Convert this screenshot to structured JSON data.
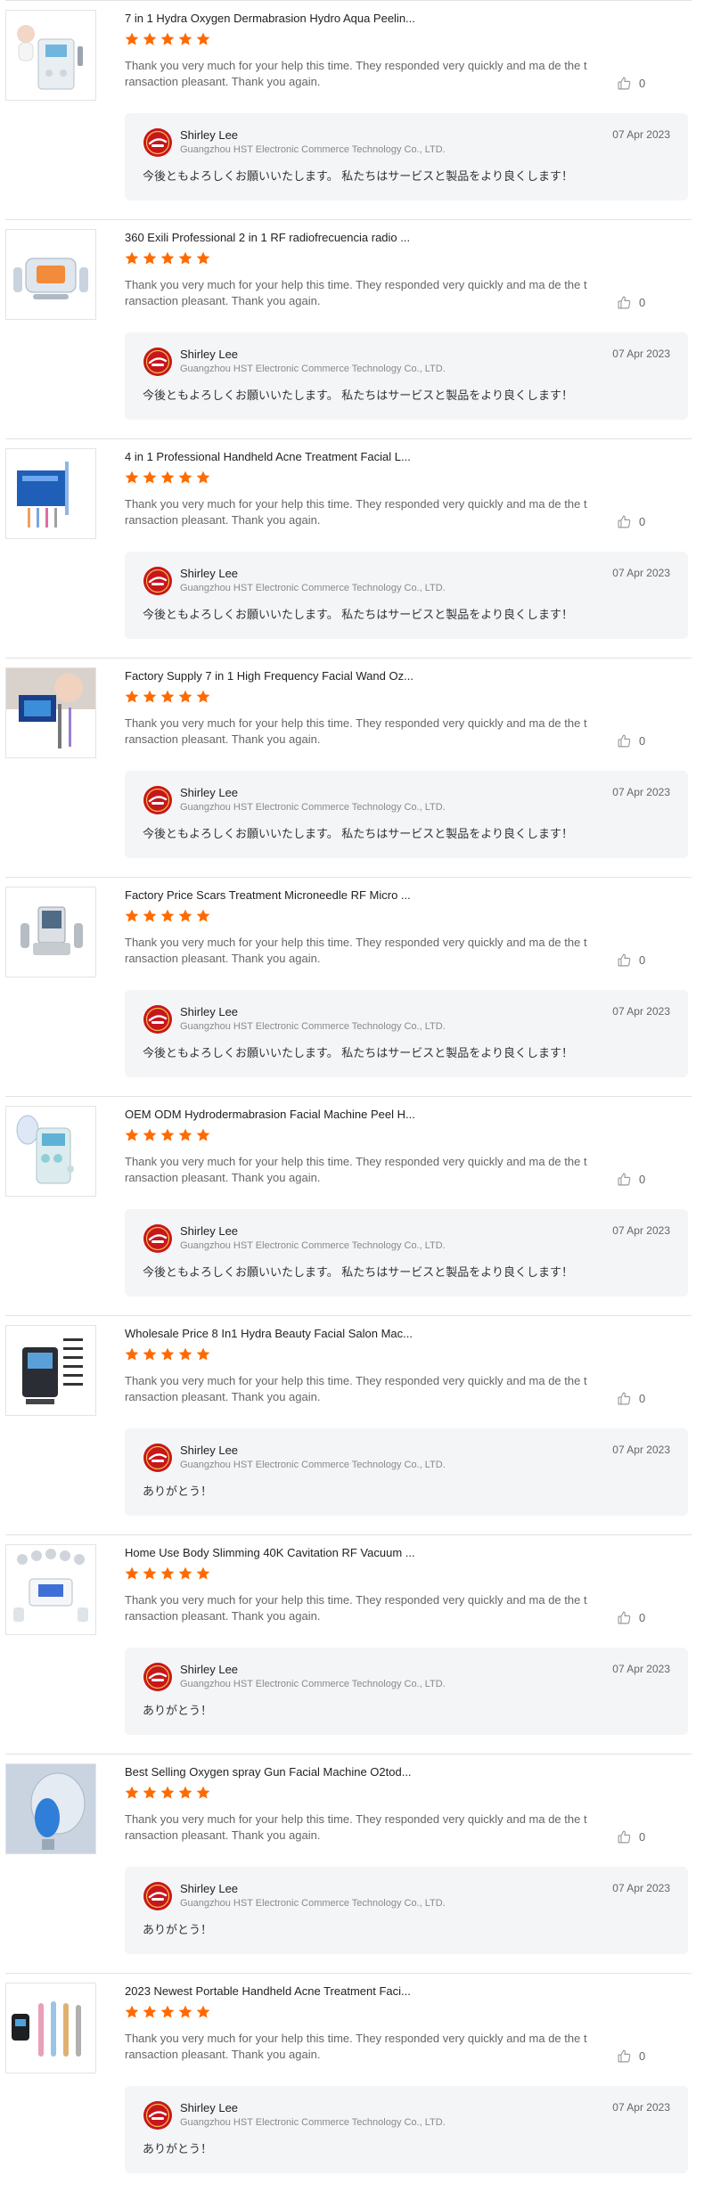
{
  "colors": {
    "star": "#ff6a00",
    "divider": "#e2e2e2",
    "reply_bg": "#f4f5f7",
    "logo": "#c8161d"
  },
  "reviews": [
    {
      "title": "7 in 1 Hydra Oxygen Dermabrasion Hydro Aqua Peelin...",
      "rating": 5,
      "comment": "Thank you very much for your help this time. They responded very quickly and ma de the transaction pleasant. Thank you again.",
      "likes": "0",
      "thumb": "hydra-machine",
      "reply": {
        "name": "Shirley Lee",
        "company": "Guangzhou HST Electronic Commerce Technology Co., LTD.",
        "date": "07 Apr 2023",
        "text": "今後ともよろしくお願いいたします。 私たちはサービスと製品をより良くします！"
      }
    },
    {
      "title": "360 Exili Professional 2 in 1 RF radiofrecuencia radio ...",
      "rating": 5,
      "comment": "Thank you very much for your help this time. They responded very quickly and ma de the transaction pleasant. Thank you again.",
      "likes": "0",
      "thumb": "rf-machine",
      "reply": {
        "name": "Shirley Lee",
        "company": "Guangzhou HST Electronic Commerce Technology Co., LTD.",
        "date": "07 Apr 2023",
        "text": "今後ともよろしくお願いいたします。 私たちはサービスと製品をより良くします！"
      }
    },
    {
      "title": "4 in 1 Professional Handheld Acne Treatment Facial L...",
      "rating": 5,
      "comment": "Thank you very much for your help this time. They responded very quickly and ma de the transaction pleasant. Thank you again.",
      "likes": "0",
      "thumb": "wand-box",
      "reply": {
        "name": "Shirley Lee",
        "company": "Guangzhou HST Electronic Commerce Technology Co., LTD.",
        "date": "07 Apr 2023",
        "text": "今後ともよろしくお願いいたします。 私たちはサービスと製品をより良くします！"
      }
    },
    {
      "title": "Factory Supply 7 in 1 High Frequency Facial Wand Oz...",
      "rating": 5,
      "comment": "Thank you very much for your help this time. They responded very quickly and ma de the transaction pleasant. Thank you again.",
      "likes": "0",
      "thumb": "face-wand",
      "reply": {
        "name": "Shirley Lee",
        "company": "Guangzhou HST Electronic Commerce Technology Co., LTD.",
        "date": "07 Apr 2023",
        "text": "今後ともよろしくお願いいたします。 私たちはサービスと製品をより良くします！"
      }
    },
    {
      "title": "Factory Price Scars Treatment Microneedle RF Micro ...",
      "rating": 5,
      "comment": "Thank you very much for your help this time. They responded very quickly and ma de the transaction pleasant. Thank you again.",
      "likes": "0",
      "thumb": "microneedle-machine",
      "reply": {
        "name": "Shirley Lee",
        "company": "Guangzhou HST Electronic Commerce Technology Co., LTD.",
        "date": "07 Apr 2023",
        "text": "今後ともよろしくお願いいたします。 私たちはサービスと製品をより良くします！"
      }
    },
    {
      "title": "OEM ODM Hydrodermabrasion Facial Machine Peel H...",
      "rating": 5,
      "comment": "Thank you very much for your help this time. They responded very quickly and ma de the transaction pleasant. Thank you again.",
      "likes": "0",
      "thumb": "led-mask-machine",
      "reply": {
        "name": "Shirley Lee",
        "company": "Guangzhou HST Electronic Commerce Technology Co., LTD.",
        "date": "07 Apr 2023",
        "text": "今後ともよろしくお願いいたします。 私たちはサービスと製品をより良くします！"
      }
    },
    {
      "title": "Wholesale Price 8 In1 Hydra Beauty Facial Salon Mac...",
      "rating": 5,
      "comment": "Thank you very much for your help this time. They responded very quickly and ma de the transaction pleasant. Thank you again.",
      "likes": "0",
      "thumb": "salon-machine",
      "reply": {
        "name": "Shirley Lee",
        "company": "Guangzhou HST Electronic Commerce Technology Co., LTD.",
        "date": "07 Apr 2023",
        "text": "ありがとう！"
      }
    },
    {
      "title": "Home Use Body Slimming 40K Cavitation RF Vacuum ...",
      "rating": 5,
      "comment": "Thank you very much for your help this time. They responded very quickly and ma de the transaction pleasant. Thank you again.",
      "likes": "0",
      "thumb": "cavitation-machine",
      "reply": {
        "name": "Shirley Lee",
        "company": "Guangzhou HST Electronic Commerce Technology Co., LTD.",
        "date": "07 Apr 2023",
        "text": "ありがとう！"
      }
    },
    {
      "title": "Best Selling Oxygen spray Gun Facial Machine O2tod...",
      "rating": 5,
      "comment": "Thank you very much for your help this time. They responded very quickly and ma de the transaction pleasant. Thank you again.",
      "likes": "0",
      "thumb": "oxygen-dome",
      "reply": {
        "name": "Shirley Lee",
        "company": "Guangzhou HST Electronic Commerce Technology Co., LTD.",
        "date": "07 Apr 2023",
        "text": "ありがとう！"
      }
    },
    {
      "title": "2023 Newest Portable Handheld Acne Treatment Faci...",
      "rating": 5,
      "comment": "Thank you very much for your help this time. They responded very quickly and ma de the transaction pleasant. Thank you again.",
      "likes": "0",
      "thumb": "handheld-wands",
      "reply": {
        "name": "Shirley Lee",
        "company": "Guangzhou HST Electronic Commerce Technology Co., LTD.",
        "date": "07 Apr 2023",
        "text": "ありがとう！"
      }
    }
  ]
}
